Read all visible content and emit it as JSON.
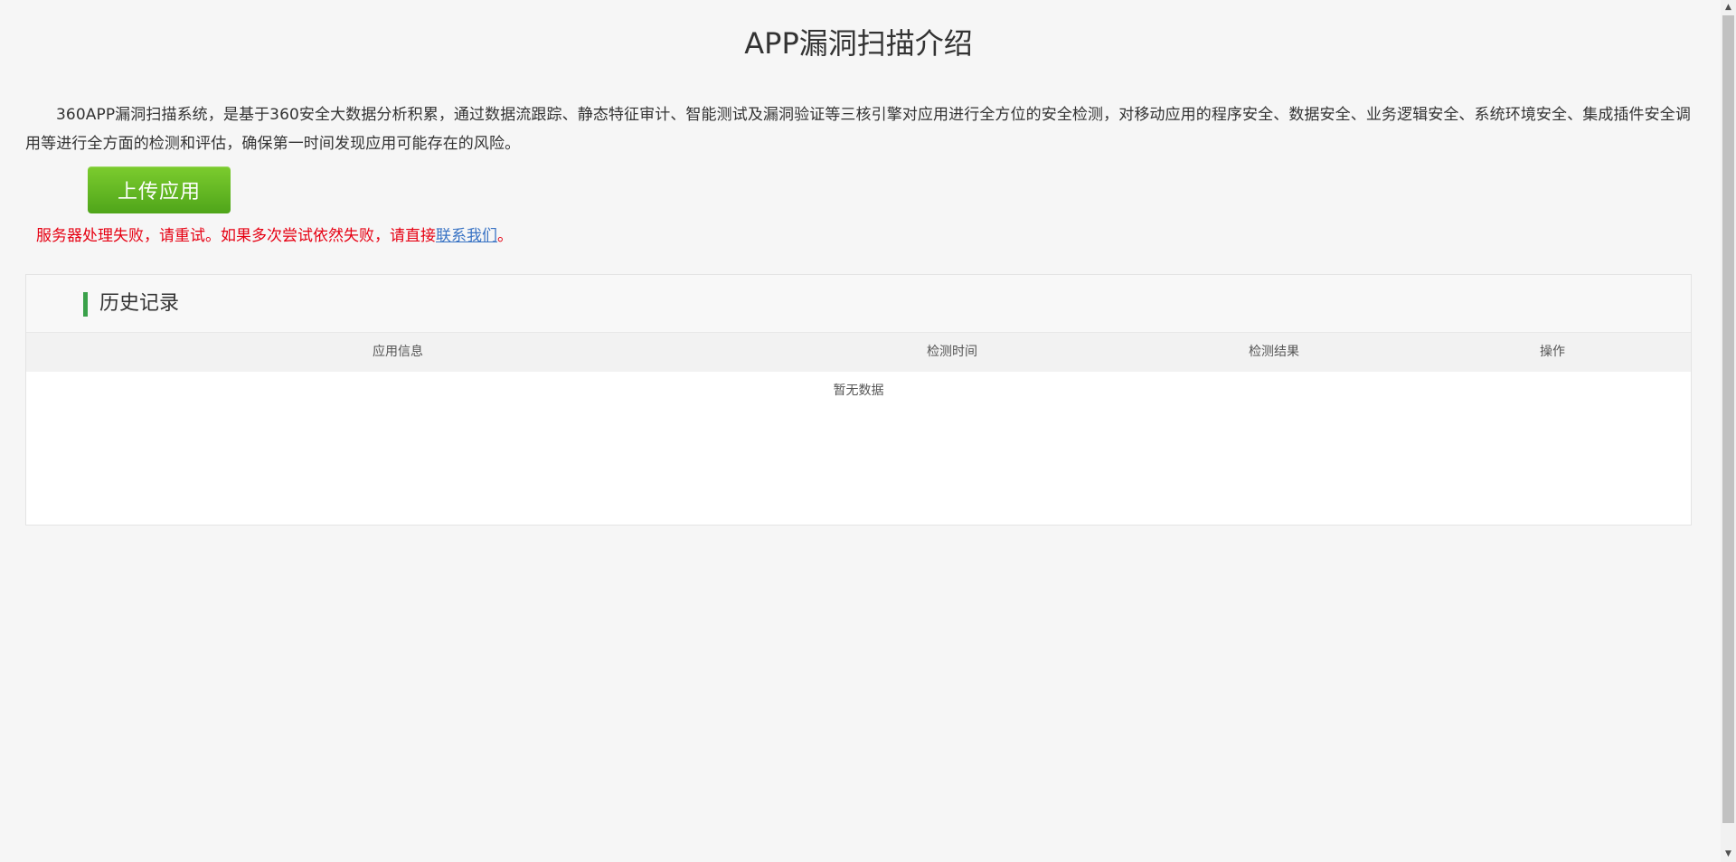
{
  "page": {
    "title": "APP漏洞扫描介绍",
    "intro": "360APP漏洞扫描系统，是基于360安全大数据分析积累，通过数据流跟踪、静态特征审计、智能测试及漏洞验证等三核引擎对应用进行全方位的安全检测，对移动应用的程序安全、数据安全、业务逻辑安全、系统环境安全、集成插件安全调用等进行全方面的检测和评估，确保第一时间发现应用可能存在的风险。"
  },
  "upload": {
    "label": "上传应用"
  },
  "error": {
    "message": "服务器处理失败，请重试。如果多次尝试依然失败，请直接",
    "link": "联系我们",
    "suffix": "。"
  },
  "history": {
    "title": "历史记录",
    "columns": [
      "应用信息",
      "检测时间",
      "检测结果",
      "操作"
    ],
    "empty_text": "暂无数据"
  },
  "colors": {
    "accent": "#3aa14a",
    "button": "#5cb521",
    "error": "#e60012",
    "link": "#3973c4"
  }
}
